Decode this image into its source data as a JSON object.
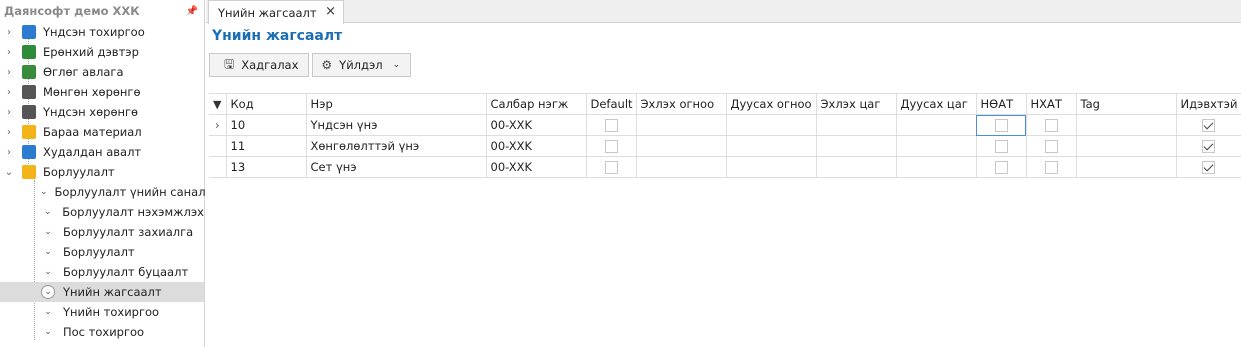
{
  "sidebar": {
    "title": "Даянсофт демо ХХК",
    "pin_icon": "pin-icon",
    "items": [
      {
        "label": "Үндсэн тохиргоо",
        "icon": "settings-grid-icon",
        "color": "#2b7bd0"
      },
      {
        "label": "Ерөнхий дэвтэр",
        "icon": "ledger-book-icon",
        "color": "#2e8b3a"
      },
      {
        "label": "Өглөг авлага",
        "icon": "money-dollar-icon",
        "color": "#3a8c3a"
      },
      {
        "label": "Мөнгөн хөрөнгө",
        "icon": "bank-icon",
        "color": "#555555"
      },
      {
        "label": "Үндсэн хөрөнгө",
        "icon": "building-icon",
        "color": "#555555"
      },
      {
        "label": "Бараа материал",
        "icon": "inventory-box-icon",
        "color": "#f2b418"
      },
      {
        "label": "Худалдан авалт",
        "icon": "truck-icon",
        "color": "#2b7bd0"
      },
      {
        "label": "Борлуулалт",
        "icon": "sales-cart-icon",
        "color": "#f2b418"
      }
    ],
    "children": [
      {
        "label": "Борлуулалт үнийн санал",
        "selected": false
      },
      {
        "label": "Борлуулалт нэхэмжлэх",
        "selected": false
      },
      {
        "label": "Борлуулалт захиалга",
        "selected": false
      },
      {
        "label": "Борлуулалт",
        "selected": false
      },
      {
        "label": "Борлуулалт буцаалт",
        "selected": false
      },
      {
        "label": "Үнийн жагсаалт",
        "selected": true
      },
      {
        "label": "Үнийн тохиргоо",
        "selected": false
      },
      {
        "label": "Пос тохиргоо",
        "selected": false
      }
    ]
  },
  "tab": {
    "label": "Үнийн жагсаалт",
    "close": "×"
  },
  "page": {
    "title": "Үнийн жагсаалт"
  },
  "toolbar": {
    "save_label": "Хадгалах",
    "actions_label": "Үйлдэл"
  },
  "grid": {
    "columns": [
      "Код",
      "Нэр",
      "Салбар нэгж",
      "Default",
      "Эхлэх огноо",
      "Дуусах огноо",
      "Эхлэх цаг",
      "Дуусах цаг",
      "НӨАТ",
      "НХАТ",
      "Tag",
      "Идэвхтэй"
    ],
    "rows": [
      {
        "code": "10",
        "name": "Үндсэн үнэ",
        "branch": "00-XXK",
        "default": false,
        "start_date": "",
        "end_date": "",
        "start_time": "",
        "end_time": "",
        "vat": false,
        "nhat": false,
        "tag": "",
        "active": true,
        "current": true
      },
      {
        "code": "11",
        "name": "Хөнгөлөлттэй үнэ",
        "branch": "00-XXK",
        "default": false,
        "start_date": "",
        "end_date": "",
        "start_time": "",
        "end_time": "",
        "vat": false,
        "nhat": false,
        "tag": "",
        "active": true,
        "current": false
      },
      {
        "code": "13",
        "name": "Сет үнэ",
        "branch": "00-XXK",
        "default": false,
        "start_date": "",
        "end_date": "",
        "start_time": "",
        "end_time": "",
        "vat": false,
        "nhat": false,
        "tag": "",
        "active": true,
        "current": false
      }
    ]
  },
  "colors": {
    "accent": "#1a6fb5",
    "selected_row": "#dcdcdc",
    "focus": "#4a90d9"
  }
}
